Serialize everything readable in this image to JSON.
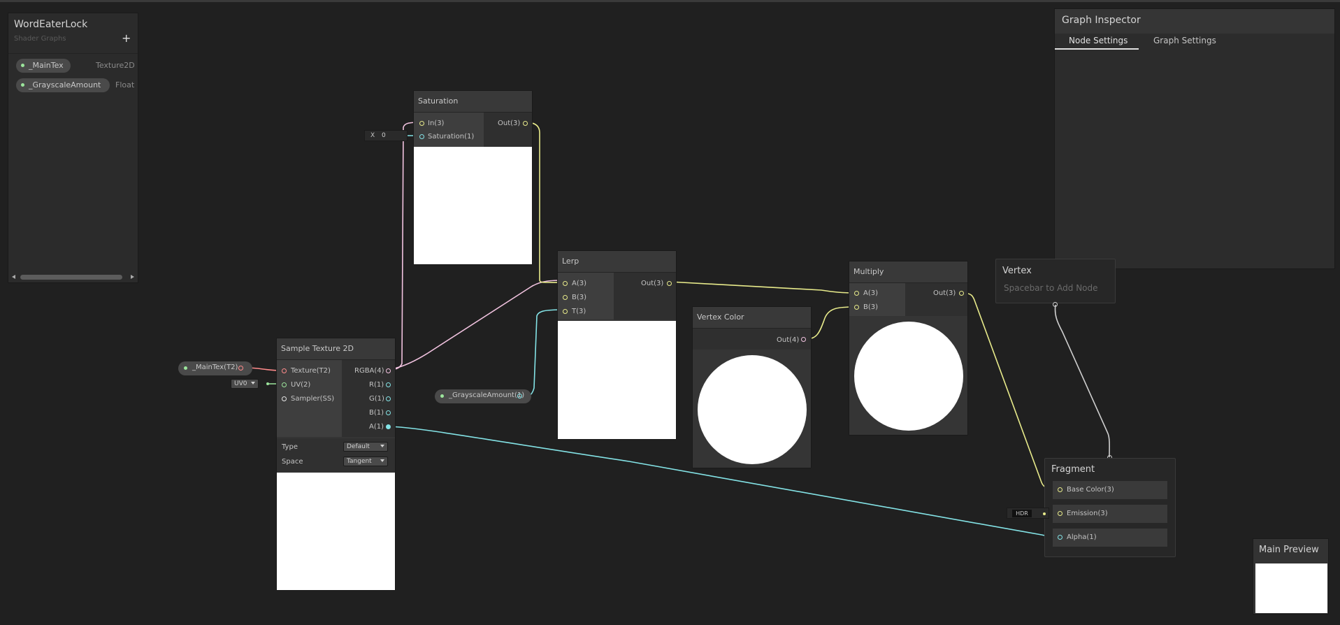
{
  "blackboard": {
    "title": "WordEaterLock",
    "subtitle": "Shader Graphs",
    "add_glyph": "+",
    "properties": [
      {
        "name": "_MainTex",
        "type": "Texture2D"
      },
      {
        "name": "_GrayscaleAmount",
        "type": "Float"
      }
    ]
  },
  "inspector": {
    "title": "Graph Inspector",
    "tabs": [
      "Node Settings",
      "Graph Settings"
    ]
  },
  "nodes": {
    "saturation": {
      "title": "Saturation",
      "in_ports": [
        "In(3)",
        "Saturation(1)"
      ],
      "out_ports": [
        "Out(3)"
      ],
      "input_field": {
        "label": "X",
        "value": "0"
      }
    },
    "lerp": {
      "title": "Lerp",
      "in_ports": [
        "A(3)",
        "B(3)",
        "T(3)"
      ],
      "out_ports": [
        "Out(3)"
      ]
    },
    "vertex_color": {
      "title": "Vertex Color",
      "out_ports": [
        "Out(4)"
      ]
    },
    "multiply": {
      "title": "Multiply",
      "in_ports": [
        "A(3)",
        "B(3)"
      ],
      "out_ports": [
        "Out(3)"
      ]
    },
    "sample_texture": {
      "title": "Sample Texture 2D",
      "in_ports": [
        "Texture(T2)",
        "UV(2)",
        "Sampler(SS)"
      ],
      "out_ports": [
        "RGBA(4)",
        "R(1)",
        "G(1)",
        "B(1)",
        "A(1)"
      ],
      "settings": [
        {
          "label": "Type",
          "value": "Default"
        },
        {
          "label": "Space",
          "value": "Tangent"
        }
      ],
      "uv_value": "UV0"
    },
    "maintex_prop": {
      "label": "_MainTex(T2)"
    },
    "grayscale_prop": {
      "label": "_GrayscaleAmount(1)"
    },
    "vertex_ctx": {
      "title": "Vertex",
      "placeholder": "Spacebar to Add Node"
    },
    "fragment_ctx": {
      "title": "Fragment",
      "ports": [
        "Base Color(3)",
        "Emission(3)",
        "Alpha(1)"
      ],
      "hdr_label": "HDR"
    }
  },
  "main_preview": {
    "title": "Main Preview"
  },
  "colors": {
    "vec3": "#e8eb8b",
    "vec4": "#f2c3e0",
    "float": "#84e4e7",
    "texture": "#ff8b8b",
    "vec2": "#9ce59c",
    "wire_white": "#cfcfcf"
  }
}
